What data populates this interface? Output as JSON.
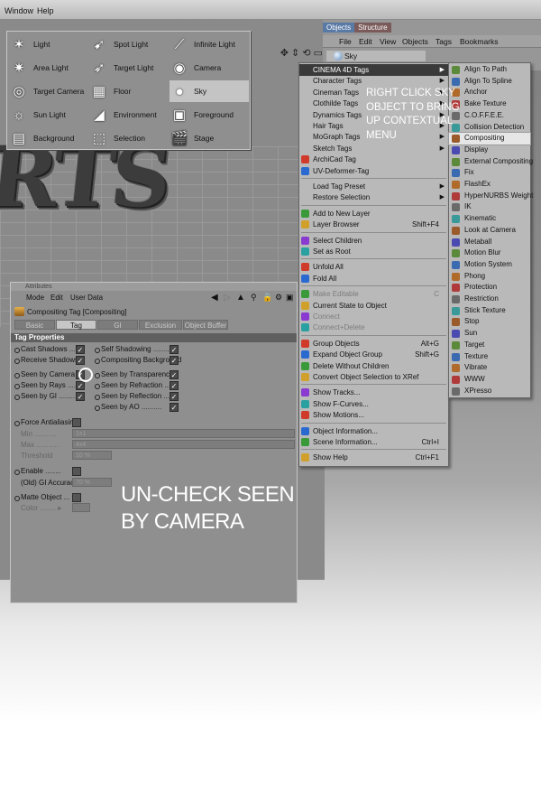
{
  "menubar": {
    "items": [
      "Window",
      "Help"
    ]
  },
  "viewport": {
    "big_text": "RTS"
  },
  "light_palette": {
    "items": [
      {
        "label": "Light",
        "icon": "light-icon"
      },
      {
        "label": "Spot Light",
        "icon": "spot-light-icon"
      },
      {
        "label": "Infinite Light",
        "icon": "infinite-light-icon"
      },
      {
        "label": "Area Light",
        "icon": "area-light-icon"
      },
      {
        "label": "Target Light",
        "icon": "target-light-icon"
      },
      {
        "label": "Camera",
        "icon": "camera-icon"
      },
      {
        "label": "Target Camera",
        "icon": "target-camera-icon"
      },
      {
        "label": "Floor",
        "icon": "floor-icon"
      },
      {
        "label": "Sky",
        "icon": "sky-icon",
        "selected": true
      },
      {
        "label": "Sun Light",
        "icon": "sun-light-icon"
      },
      {
        "label": "Environment",
        "icon": "environment-icon"
      },
      {
        "label": "Foreground",
        "icon": "foreground-icon"
      },
      {
        "label": "Background",
        "icon": "background-icon"
      },
      {
        "label": "Selection",
        "icon": "selection-icon"
      },
      {
        "label": "Stage",
        "icon": "stage-icon"
      }
    ]
  },
  "objects_panel": {
    "tabs": [
      "Objects",
      "Structure"
    ],
    "menu": [
      "File",
      "Edit",
      "View",
      "Objects",
      "Tags",
      "Bookmarks"
    ],
    "object_name": "Sky"
  },
  "context_menu": {
    "groups": [
      [
        {
          "label": "CINEMA 4D Tags",
          "submenu": true,
          "selected": true
        },
        {
          "label": "Character Tags",
          "submenu": true
        },
        {
          "label": "Cineman Tags",
          "submenu": true
        },
        {
          "label": "Clothilde Tags",
          "submenu": true
        },
        {
          "label": "Dynamics Tags",
          "submenu": true
        },
        {
          "label": "Hair Tags",
          "submenu": true
        },
        {
          "label": "MoGraph Tags",
          "submenu": true
        },
        {
          "label": "Sketch Tags",
          "submenu": true
        },
        {
          "label": "ArchiCad Tag",
          "icon": "archicad-tag-icon"
        },
        {
          "label": "UV-Deformer-Tag",
          "icon": "uv-deformer-tag-icon"
        }
      ],
      [
        {
          "label": "Load Tag Preset",
          "submenu": true
        },
        {
          "label": "Restore Selection",
          "submenu": true
        }
      ],
      [
        {
          "label": "Add to New Layer",
          "icon": "add-layer-icon"
        },
        {
          "label": "Layer Browser",
          "shortcut": "Shift+F4",
          "icon": "layer-browser-icon"
        }
      ],
      [
        {
          "label": "Select Children",
          "icon": "select-children-icon"
        },
        {
          "label": "Set as Root",
          "icon": "set-root-icon"
        }
      ],
      [
        {
          "label": "Unfold All",
          "icon": "unfold-icon"
        },
        {
          "label": "Fold All",
          "icon": "fold-icon"
        }
      ],
      [
        {
          "label": "Make Editable",
          "shortcut": "C",
          "disabled": true,
          "icon": "make-editable-icon"
        },
        {
          "label": "Current State to Object",
          "icon": "current-state-icon"
        },
        {
          "label": "Connect",
          "disabled": true,
          "icon": "connect-icon"
        },
        {
          "label": "Connect+Delete",
          "disabled": true,
          "icon": "connect-delete-icon"
        }
      ],
      [
        {
          "label": "Group Objects",
          "shortcut": "Alt+G",
          "icon": "group-icon"
        },
        {
          "label": "Expand Object Group",
          "shortcut": "Shift+G",
          "icon": "expand-group-icon"
        },
        {
          "label": "Delete Without Children",
          "icon": "delete-icon"
        },
        {
          "label": "Convert Object Selection to XRef",
          "icon": "xref-icon"
        }
      ],
      [
        {
          "label": "Show Tracks...",
          "icon": "tracks-icon"
        },
        {
          "label": "Show F-Curves...",
          "icon": "fcurves-icon"
        },
        {
          "label": "Show Motions...",
          "icon": "motions-icon"
        }
      ],
      [
        {
          "label": "Object Information...",
          "icon": "info-icon"
        },
        {
          "label": "Scene Information...",
          "shortcut": "Ctrl+I",
          "icon": "scene-info-icon"
        }
      ],
      [
        {
          "label": "Show Help",
          "shortcut": "Ctrl+F1",
          "icon": "help-icon"
        }
      ]
    ]
  },
  "submenu": {
    "items": [
      "Align To Path",
      "Align To Spline",
      "Anchor",
      "Bake Texture",
      "C.O.F.F.E.E.",
      "Collision Detection",
      "Compositing",
      "Display",
      "External Compositing",
      "Fix",
      "FlashEx",
      "HyperNURBS Weight",
      "IK",
      "Kinematic",
      "Look at Camera",
      "Metaball",
      "Motion Blur",
      "Motion System",
      "Phong",
      "Protection",
      "Restriction",
      "Stick Texture",
      "Stop",
      "Sun",
      "Target",
      "Texture",
      "Vibrate",
      "WWW",
      "XPresso"
    ],
    "selected": "Compositing"
  },
  "instruction": "Right click sky object to bring up contextual menu",
  "attributes": {
    "title": "Attributes",
    "menu": [
      "Mode",
      "Edit",
      "User Data"
    ],
    "tag_name": "Compositing Tag [Compositing]",
    "tabs": [
      "Basic",
      "Tag",
      "GI",
      "Exclusion",
      "Object Buffer"
    ],
    "active_tab": "Tag",
    "section": "Tag Properties",
    "left_options": [
      {
        "label": "Cast Shadows",
        "checked": true
      },
      {
        "label": "Receive Shadows",
        "checked": true
      },
      {
        "label": "Seen by Camera",
        "checked": true
      },
      {
        "label": "Seen by Rays",
        "checked": true
      },
      {
        "label": "Seen by GI",
        "checked": true
      }
    ],
    "right_options": [
      {
        "label": "Self Shadowing",
        "checked": true
      },
      {
        "label": "Compositing Background",
        "checked": true
      },
      {
        "label": "Seen by Transparency",
        "checked": true
      },
      {
        "label": "Seen by Refraction",
        "checked": true
      },
      {
        "label": "Seen by Reflection",
        "checked": true
      },
      {
        "label": "Seen by AO",
        "checked": true
      }
    ],
    "force_antialiasing": {
      "label": "Force Antialiasing",
      "checked": false
    },
    "min": {
      "label": "Min",
      "value": "1x1"
    },
    "max": {
      "label": "Max",
      "value": "4x4"
    },
    "threshold": {
      "label": "Threshold",
      "value": "10 %"
    },
    "enable": {
      "label": "Enable",
      "checked": false
    },
    "gi_accuracy": {
      "label": "(Old) GI Accuracy",
      "value": "70 %"
    },
    "matte_object": {
      "label": "Matte Object",
      "checked": false
    },
    "color": {
      "label": "Color"
    }
  },
  "caption": "Un-check seen by camera",
  "colors": {
    "accent_highlight": "#3a3a3a",
    "panel": "#8f8f8f",
    "menu": "#b9b9b9"
  }
}
